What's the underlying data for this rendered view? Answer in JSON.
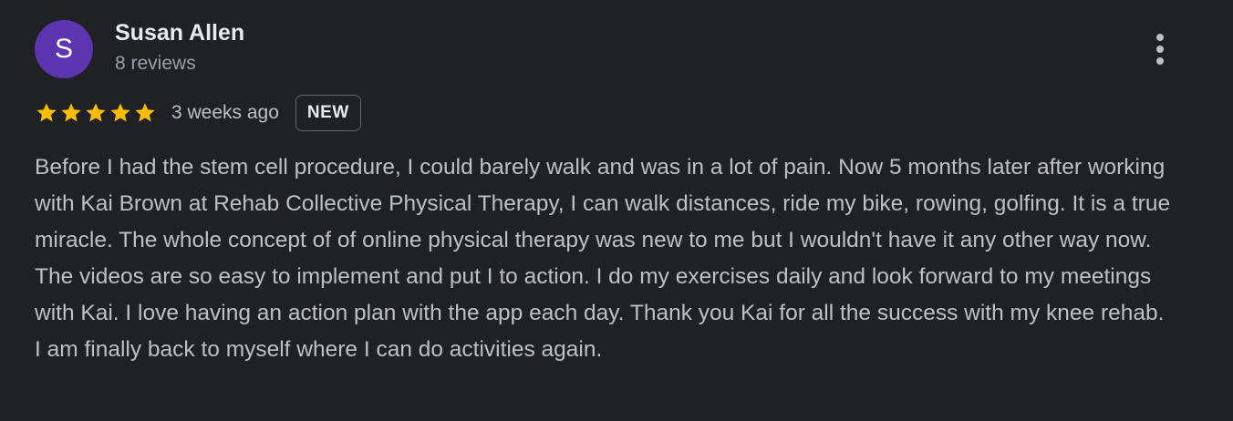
{
  "review": {
    "avatar_initial": "S",
    "reviewer_name": "Susan Allen",
    "review_count": "8 reviews",
    "rating": 5,
    "max_rating": 5,
    "time_ago": "3 weeks ago",
    "badge": "NEW",
    "text": "Before I had the stem cell procedure, I could barely walk and was in a lot of pain. Now 5 months later after working with Kai Brown at Rehab Collective Physical Therapy, I can walk distances, ride my bike, rowing, golfing. It is a true miracle. The whole concept of of online physical therapy was new to me but I wouldn't have it any other way now. The videos are so easy to implement and put I to action. I do my exercises daily and look forward to my meetings with Kai. I love having an action plan with the app each day. Thank you Kai for all the success with my knee rehab. I am finally back to myself where I can do activities again."
  },
  "icons": {
    "more": "more-vert-icon",
    "star": "star-icon"
  },
  "colors": {
    "background": "#202124",
    "avatar": "#5e35b1",
    "star": "#fbbc04",
    "primary_text": "#e8eaed",
    "secondary_text": "#bdc1c6"
  }
}
